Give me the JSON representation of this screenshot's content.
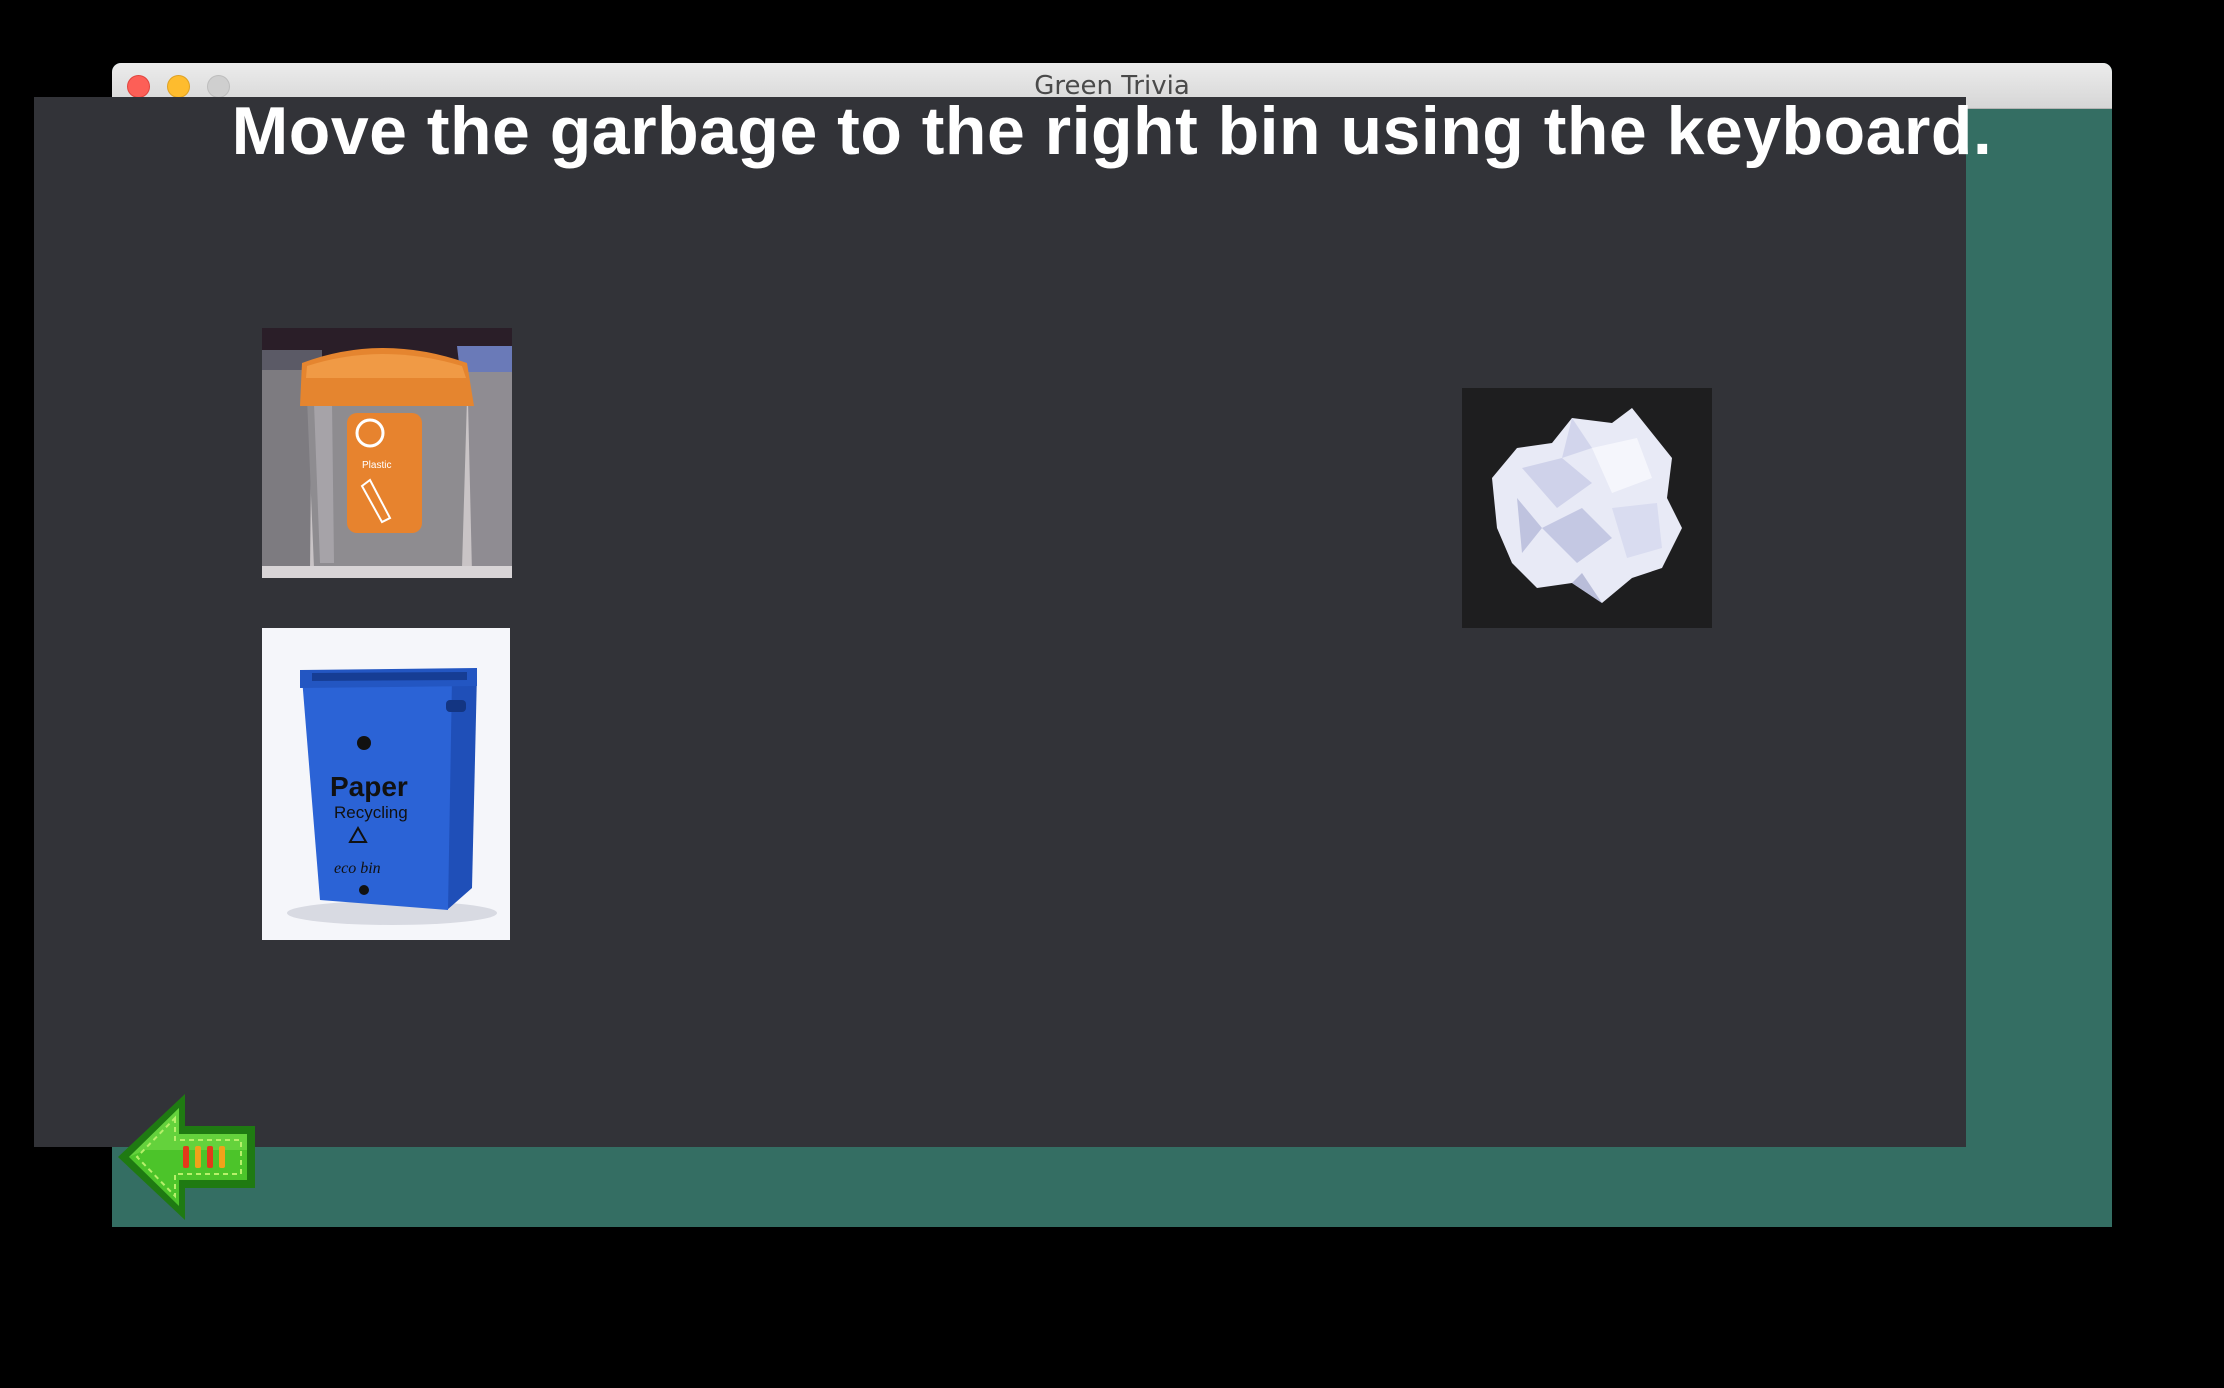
{
  "window": {
    "title": "Green Trivia"
  },
  "game": {
    "instruction": "Move the garbage to the right bin using the keyboard.",
    "bins": [
      {
        "name": "plastic-bin",
        "icon": "orange-plastic-recycling-bin-image"
      },
      {
        "name": "paper-bin",
        "icon": "blue-paper-recycling-bin-image",
        "printed_text": [
          "Paper",
          "Recycling",
          "eco bin"
        ]
      }
    ],
    "garbage": {
      "icon": "crumpled-paper-image"
    },
    "back_button": {
      "icon": "green-back-arrow-icon"
    }
  },
  "colors": {
    "window_frame": "#346e63",
    "board": "#323338",
    "instruction_text": "#ffffff",
    "back_arrow": "#3db31d"
  }
}
